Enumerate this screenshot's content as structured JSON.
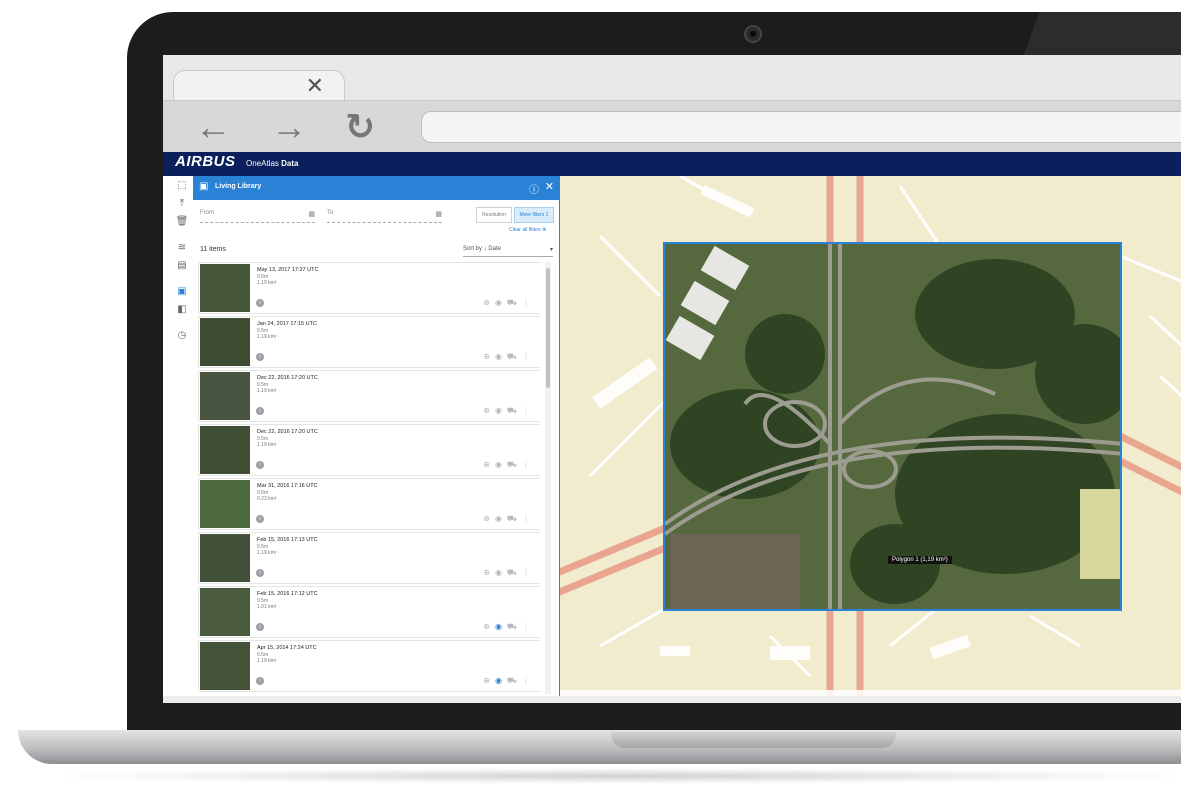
{
  "brand": {
    "logo": "AIRBUS",
    "product_prefix": "OneAtlas",
    "product_name": "Data",
    "header_color": "#0a1f5c",
    "accent": "#2a82d6"
  },
  "browser": {
    "tab_close_icon": "close-icon",
    "nav_icons": [
      "back-arrow-icon",
      "forward-arrow-icon",
      "reload-icon"
    ]
  },
  "panel": {
    "title": "Living Library",
    "filters": {
      "from_placeholder": "From",
      "to_placeholder": "To",
      "resolution_label": "Resolution",
      "more_filters_label": "More filters 1",
      "clear_filters_label": "Clear all filters"
    },
    "items_count": "11 items",
    "sort_label": "Sort by ↓ Date",
    "items": [
      {
        "date": "May 13, 2017 17:27 UTC",
        "resolution": "0.5m",
        "area": "1.19 km²",
        "preview_active": false
      },
      {
        "date": "Jan 24, 2017 17:15 UTC",
        "resolution": "0.5m",
        "area": "1.19 km²",
        "preview_active": false
      },
      {
        "date": "Dec 22, 2016 17:20 UTC",
        "resolution": "0.5m",
        "area": "1.19 km²",
        "preview_active": false
      },
      {
        "date": "Dec 22, 2016 17:20 UTC",
        "resolution": "0.5m",
        "area": "1.19 km²",
        "preview_active": false
      },
      {
        "date": "Mar 31, 2016 17:16 UTC",
        "resolution": "0.5m",
        "area": "0.23 km²",
        "preview_active": false
      },
      {
        "date": "Feb 15, 2016 17:13 UTC",
        "resolution": "0.5m",
        "area": "1.19 km²",
        "preview_active": false
      },
      {
        "date": "Feb 15, 2016 17:12 UTC",
        "resolution": "0.5m",
        "area": "1.01 km²",
        "preview_active": true
      },
      {
        "date": "Apr 15, 2014 17:24 UTC",
        "resolution": "0.5m",
        "area": "1.19 km²",
        "preview_active": true
      }
    ]
  },
  "map": {
    "polygon_label": "Polygon 1 (1,19 km²)",
    "road_color": "#e9a58f",
    "water_color": "#a7c7e5"
  }
}
